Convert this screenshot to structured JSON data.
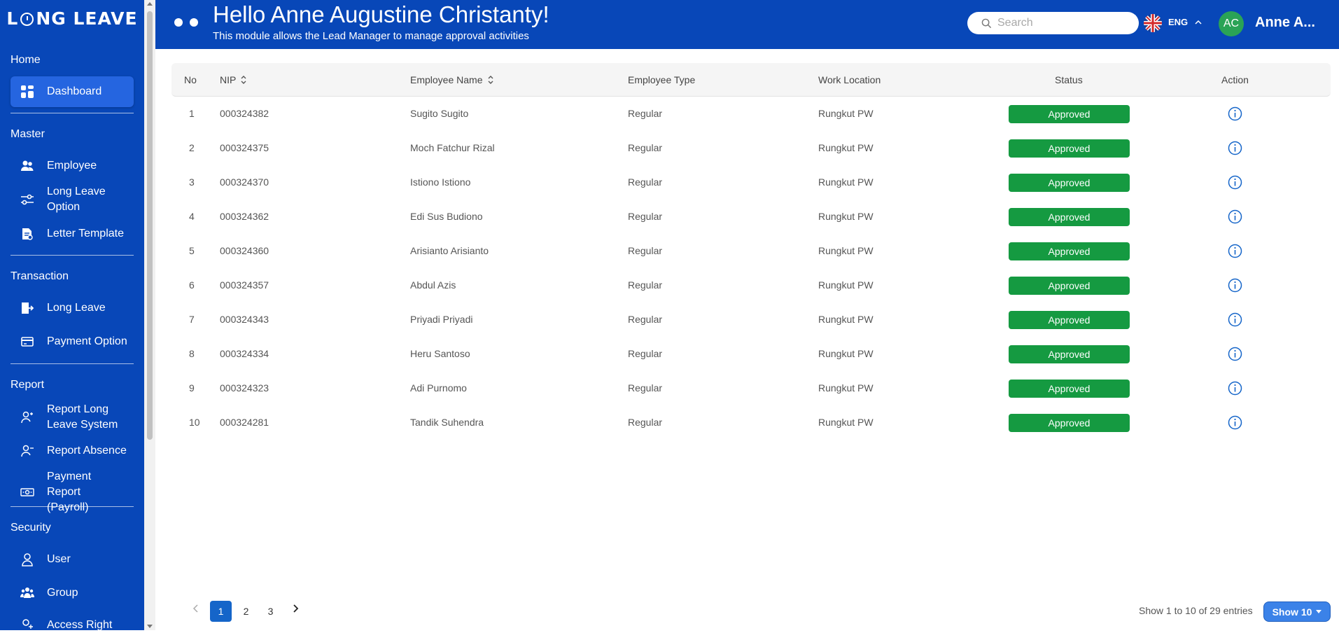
{
  "app": {
    "logo_left": "L",
    "logo_right": "NG LEAVE"
  },
  "sidebar": {
    "sections": [
      {
        "title": "Home",
        "items": [
          {
            "label": "Dashboard",
            "icon": "dashboard-icon",
            "active": true
          }
        ]
      },
      {
        "title": "Master",
        "items": [
          {
            "label": "Employee",
            "icon": "users-icon"
          },
          {
            "label": "Long Leave Option",
            "icon": "sliders-icon"
          },
          {
            "label": "Letter Template",
            "icon": "document-icon"
          }
        ]
      },
      {
        "title": "Transaction",
        "items": [
          {
            "label": "Long Leave",
            "icon": "leave-icon"
          },
          {
            "label": "Payment Option",
            "icon": "card-icon"
          }
        ]
      },
      {
        "title": "Report",
        "items": [
          {
            "label": "Report Long Leave System",
            "icon": "user-report-icon"
          },
          {
            "label": "Report Absence",
            "icon": "user-absence-icon"
          },
          {
            "label": "Payment Report (Payroll)",
            "icon": "money-icon"
          }
        ]
      },
      {
        "title": "Security",
        "items": [
          {
            "label": "User",
            "icon": "user-icon"
          },
          {
            "label": "Group",
            "icon": "group-icon"
          },
          {
            "label": "Access Right",
            "icon": "access-icon"
          }
        ]
      }
    ]
  },
  "header": {
    "title": "Hello Anne Augustine Christanty!",
    "subtitle": "This module allows the Lead Manager to manage approval activities",
    "search_placeholder": "Search",
    "language": "ENG",
    "avatar_initials": "AC",
    "username": "Anne A..."
  },
  "table": {
    "columns": [
      "No",
      "NIP",
      "Employee Name",
      "Employee Type",
      "Work Location",
      "Status",
      "Action"
    ],
    "rows": [
      {
        "no": "1",
        "nip": "000324382",
        "name": "Sugito Sugito",
        "type": "Regular",
        "location": "Rungkut PW",
        "status": "Approved"
      },
      {
        "no": "2",
        "nip": "000324375",
        "name": "Moch Fatchur Rizal",
        "type": "Regular",
        "location": "Rungkut PW",
        "status": "Approved"
      },
      {
        "no": "3",
        "nip": "000324370",
        "name": "Istiono Istiono",
        "type": "Regular",
        "location": "Rungkut PW",
        "status": "Approved"
      },
      {
        "no": "4",
        "nip": "000324362",
        "name": "Edi Sus Budiono",
        "type": "Regular",
        "location": "Rungkut PW",
        "status": "Approved"
      },
      {
        "no": "5",
        "nip": "000324360",
        "name": "Arisianto Arisianto",
        "type": "Regular",
        "location": "Rungkut PW",
        "status": "Approved"
      },
      {
        "no": "6",
        "nip": "000324357",
        "name": "Abdul Azis",
        "type": "Regular",
        "location": "Rungkut PW",
        "status": "Approved"
      },
      {
        "no": "7",
        "nip": "000324343",
        "name": "Priyadi Priyadi",
        "type": "Regular",
        "location": "Rungkut PW",
        "status": "Approved"
      },
      {
        "no": "8",
        "nip": "000324334",
        "name": "Heru Santoso",
        "type": "Regular",
        "location": "Rungkut PW",
        "status": "Approved"
      },
      {
        "no": "9",
        "nip": "000324323",
        "name": "Adi Purnomo",
        "type": "Regular",
        "location": "Rungkut PW",
        "status": "Approved"
      },
      {
        "no": "10",
        "nip": "000324281",
        "name": "Tandik Suhendra",
        "type": "Regular",
        "location": "Rungkut PW",
        "status": "Approved"
      }
    ]
  },
  "pagination": {
    "pages": [
      "1",
      "2",
      "3"
    ],
    "current": "1",
    "entries_text": "Show 1 to 10 of 29 entries",
    "show_label": "Show 10"
  },
  "colors": {
    "brand": "#0847b8",
    "status_approved": "#159a41",
    "active_page": "#1565c9"
  }
}
